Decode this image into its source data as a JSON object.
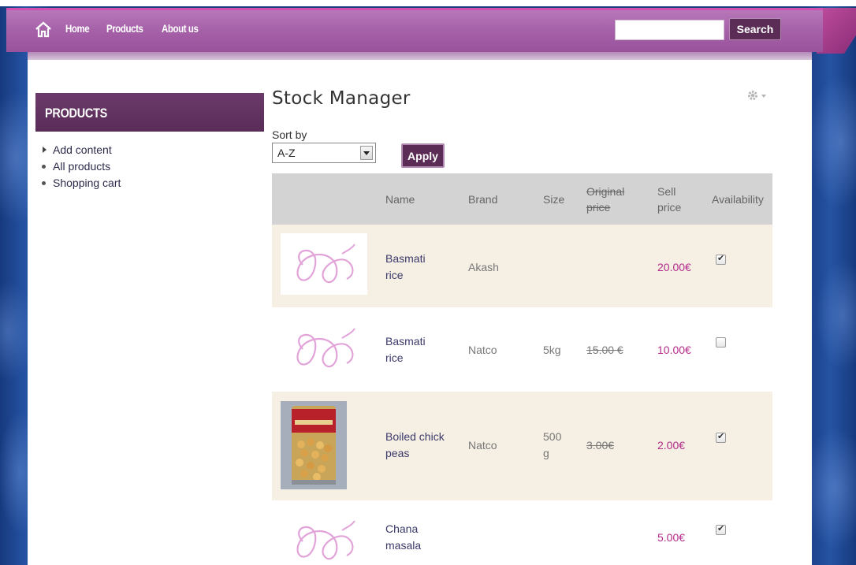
{
  "nav": {
    "items": [
      {
        "label": "Home",
        "icon": "home-icon"
      },
      {
        "label": "Products"
      },
      {
        "label": "About us"
      }
    ],
    "search_placeholder": "",
    "search_label": "Search"
  },
  "sidebar": {
    "title": "PRODUCTS",
    "items": [
      {
        "label": "Add content",
        "marker": "triangle"
      },
      {
        "label": "All products",
        "marker": "bullet"
      },
      {
        "label": "Shopping cart",
        "marker": "bullet"
      }
    ]
  },
  "main": {
    "title": "Stock Manager",
    "sort_label": "Sort by",
    "sort_value": "A-Z",
    "apply_label": "Apply",
    "table": {
      "headers": {
        "name": "Name",
        "brand": "Brand",
        "size": "Size",
        "original_price": "Original price",
        "sell_price": "Sell price",
        "availability": "Availability"
      },
      "rows": [
        {
          "name": "Basmati rice",
          "brand": "Akash",
          "size": "",
          "original_price": "",
          "sell_price": "20.00€",
          "available": true,
          "image": "logo"
        },
        {
          "name": "Basmati rice",
          "brand": "Natco",
          "size": "5kg",
          "original_price": "15.00 €",
          "sell_price": "10.00€",
          "available": false,
          "image": "logo"
        },
        {
          "name": "Boiled chick peas",
          "brand": "Natco",
          "size": "500 g",
          "original_price": "3.00€",
          "sell_price": "2.00€",
          "available": true,
          "image": "can"
        },
        {
          "name": "Chana masala",
          "brand": "",
          "size": "",
          "original_price": "",
          "sell_price": "5.00€",
          "available": true,
          "image": "logo"
        }
      ]
    }
  },
  "colors": {
    "nav_bg": "#a560a8",
    "accent_dark": "#5b2c56",
    "price": "#b42a8a",
    "row_alt": "#f5efe4",
    "header_bg": "#d3d3d3"
  }
}
